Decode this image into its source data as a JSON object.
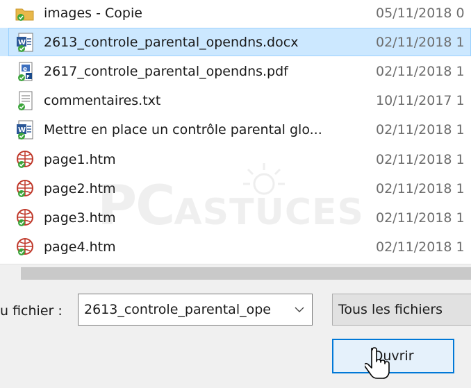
{
  "files": [
    {
      "name": "images - Copie",
      "date": "05/11/2018 0",
      "icon": "folder-icon",
      "selected": false
    },
    {
      "name": "2613_controle_parental_opendns.docx",
      "date": "02/11/2018 1",
      "icon": "word-document-icon",
      "selected": true
    },
    {
      "name": "2617_controle_parental_opendns.pdf",
      "date": "02/11/2018 1",
      "icon": "pdf-document-icon",
      "selected": false
    },
    {
      "name": "commentaires.txt",
      "date": "10/11/2017 1",
      "icon": "text-document-icon",
      "selected": false
    },
    {
      "name": "Mettre en place un contrôle parental glo...",
      "date": "02/11/2018 1",
      "icon": "word-document-icon",
      "selected": false
    },
    {
      "name": "page1.htm",
      "date": "02/11/2018 1",
      "icon": "html-document-icon",
      "selected": false
    },
    {
      "name": "page2.htm",
      "date": "02/11/2018 1",
      "icon": "html-document-icon",
      "selected": false
    },
    {
      "name": "page3.htm",
      "date": "02/11/2018 1",
      "icon": "html-document-icon",
      "selected": false
    },
    {
      "name": "page4.htm",
      "date": "02/11/2018 1",
      "icon": "html-document-icon",
      "selected": false
    }
  ],
  "watermark": {
    "part1": "PC",
    "part2": "ASTUCES"
  },
  "bottom": {
    "filename_label": "u fichier :",
    "filename_value": "2613_controle_parental_ope",
    "filetype_value": "Tous les fichiers",
    "open_label": "Ouvrir"
  }
}
